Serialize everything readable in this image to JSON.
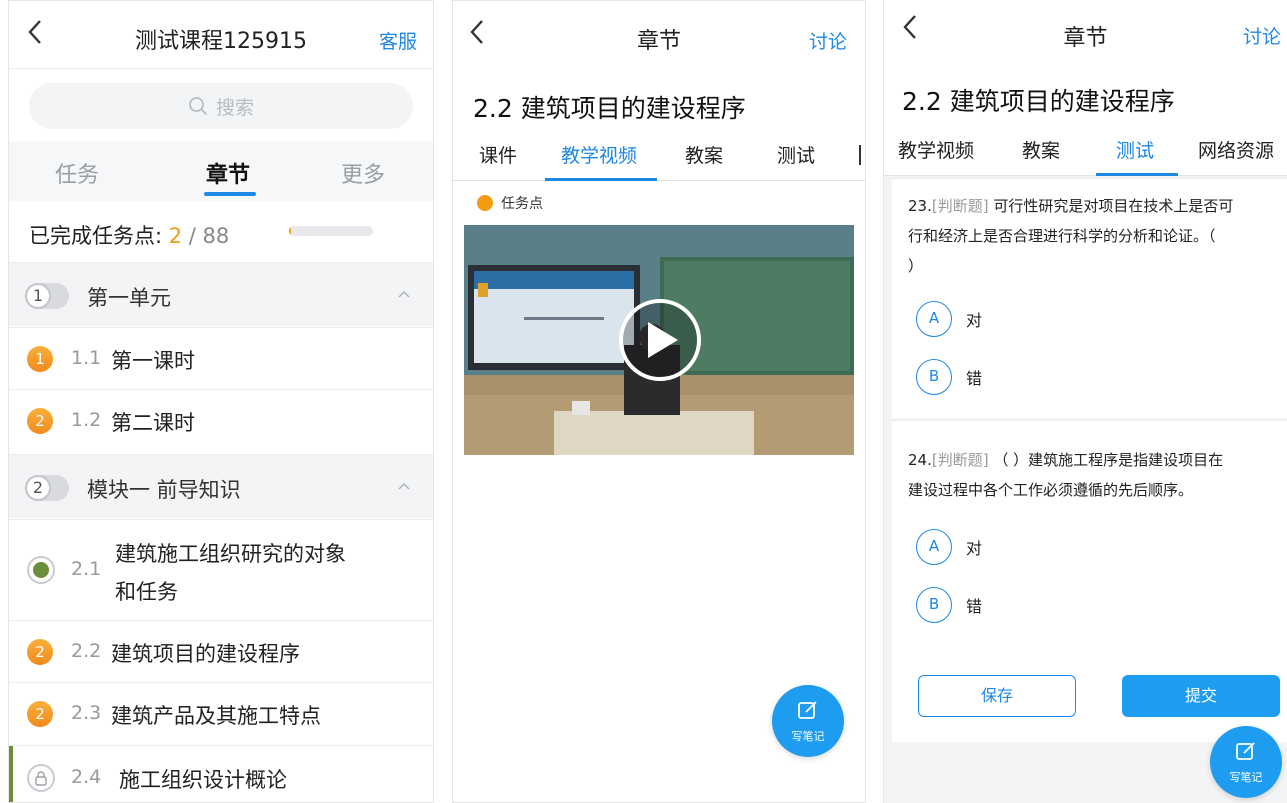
{
  "panel1": {
    "title": "测试课程125915",
    "right_link": "客服",
    "search_placeholder": "搜索",
    "tabs": [
      "任务",
      "章节",
      "更多"
    ],
    "active_tab": "章节",
    "progress": {
      "label": "已完成任务点: ",
      "done": "2",
      "total": " / 88",
      "fraction": 0.023
    },
    "units": [
      {
        "badge": "1",
        "title": "第一单元"
      },
      {
        "badge": "2",
        "title": "模块一 前导知识"
      }
    ],
    "lessons": [
      {
        "badge": "1",
        "num": "1.1",
        "title": "第一课时",
        "status": "task"
      },
      {
        "badge": "2",
        "num": "1.2",
        "title": "第二课时",
        "status": "task"
      },
      {
        "badge": "",
        "num": "2.1",
        "title_line1": "建筑施工组织研究的对象",
        "title_line2": "和任务",
        "status": "completed"
      },
      {
        "badge": "2",
        "num": "2.2",
        "title": "建筑项目的建设程序",
        "status": "task"
      },
      {
        "badge": "2",
        "num": "2.3",
        "title": "建筑产品及其施工特点",
        "status": "task"
      },
      {
        "badge": "",
        "num": "2.4",
        "title": "施工组织设计概论",
        "status": "locked"
      }
    ]
  },
  "panel2": {
    "title": "章节",
    "right_link": "讨论",
    "heading": "2.2 建筑项目的建设程序",
    "tabs": [
      "课件",
      "教学视频",
      "教案",
      "测试"
    ],
    "active_tab": "教学视频",
    "task_point": "任务点",
    "note_button": "写笔记",
    "colors": {
      "accent": "#1e88e5",
      "task_dot": "#f39c12"
    }
  },
  "panel3": {
    "title": "章节",
    "right_link": "讨论",
    "heading": "2.2 建筑项目的建设程序",
    "tabs": [
      "教学视频",
      "教案",
      "测试",
      "网络资源"
    ],
    "active_tab": "测试",
    "questions": [
      {
        "number": "23.",
        "type": "[判断题]",
        "line1": " 可行性研究是对项目在技术上是否可",
        "line2": "行和经济上是否合理进行科学的分析和论证。（",
        "line3": "）",
        "options": [
          {
            "letter": "A",
            "text": "对"
          },
          {
            "letter": "B",
            "text": "错"
          }
        ]
      },
      {
        "number": "24.",
        "type": "[判断题]",
        "line1": " （ ）建筑施工程序是指建设项目在",
        "line2": "建设过程中各个工作必须遵循的先后顺序。",
        "options": [
          {
            "letter": "A",
            "text": "对"
          },
          {
            "letter": "B",
            "text": "错"
          }
        ]
      }
    ],
    "save_button": "保存",
    "submit_button": "提交",
    "note_button": "写笔记"
  }
}
